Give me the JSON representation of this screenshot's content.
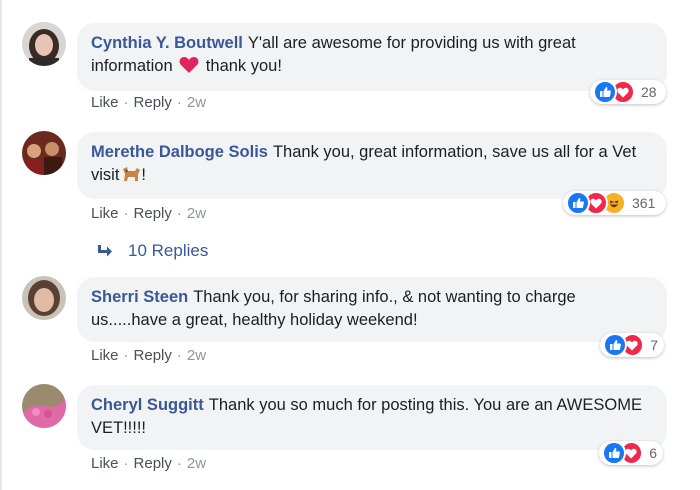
{
  "comments": [
    {
      "author": "Cynthia Y. Boutwell",
      "text_before": "Y'all are awesome for providing us with great information",
      "text_after": " thank you!",
      "emoji": "heart-emoji",
      "like_label": "Like",
      "reply_label": "Reply",
      "time": "2w",
      "reactions": [
        "like-icon",
        "love-icon"
      ],
      "reaction_count": "28"
    },
    {
      "author": "Merethe Dalboge Solis",
      "text_before": "Thank you, great information, save us all for a Vet visit",
      "text_after": "!",
      "emoji": "dog-emoji",
      "like_label": "Like",
      "reply_label": "Reply",
      "time": "2w",
      "reactions": [
        "like-icon",
        "love-icon",
        "haha-icon"
      ],
      "reaction_count": "361"
    },
    {
      "author": "Sherri Steen",
      "text": "Thank you, for sharing info., & not wanting to charge us.....have a great, healthy holiday weekend!",
      "like_label": "Like",
      "reply_label": "Reply",
      "time": "2w",
      "reactions": [
        "like-icon",
        "love-icon"
      ],
      "reaction_count": "7"
    },
    {
      "author": "Cheryl Suggitt",
      "text": "Thank you so much for posting this. You are an AWESOME VET!!!!!",
      "like_label": "Like",
      "reply_label": "Reply",
      "time": "2w",
      "reactions": [
        "like-icon",
        "love-icon"
      ],
      "reaction_count": "6"
    }
  ],
  "replies_link": {
    "label": "10 Replies",
    "icon": "reply-arrow-icon"
  },
  "colors": {
    "author": "#385898",
    "bubble": "#f2f3f5",
    "meta": "#90949c",
    "like": "#1877f2",
    "love": "#f0284a",
    "haha": "#f7b125"
  }
}
